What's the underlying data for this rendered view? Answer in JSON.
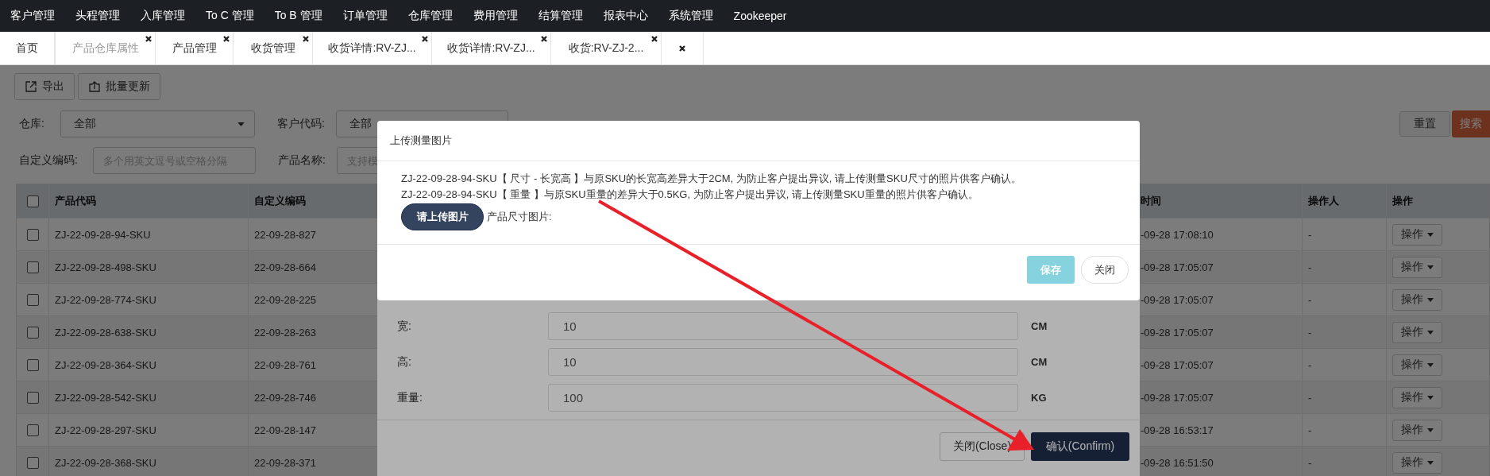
{
  "nav": [
    "客户管理",
    "头程管理",
    "入库管理",
    "To C 管理",
    "To B 管理",
    "订单管理",
    "仓库管理",
    "费用管理",
    "结算管理",
    "报表中心",
    "系统管理",
    "Zookeeper"
  ],
  "tabs": [
    {
      "kind": "page",
      "label": "首页",
      "selected": false,
      "closable": false
    },
    {
      "kind": "page",
      "label": "产品仓库属性",
      "selected": true,
      "closable": true
    },
    {
      "kind": "page",
      "label": "产品管理",
      "selected": false,
      "closable": true
    },
    {
      "kind": "page",
      "label": "收货管理",
      "selected": false,
      "closable": true
    },
    {
      "kind": "page",
      "label": "收货详情:RV-ZJ...",
      "selected": false,
      "closable": true
    },
    {
      "kind": "page",
      "label": "收货详情:RV-ZJ...",
      "selected": false,
      "closable": true
    },
    {
      "kind": "page",
      "label": "收货:RV-ZJ-2...",
      "selected": false,
      "closable": true
    },
    {
      "kind": "close",
      "selected": false,
      "closable": true
    }
  ],
  "toolbar": [
    {
      "kind": "export",
      "label": "导出"
    },
    {
      "kind": "upload",
      "label": "批量更新"
    }
  ],
  "filters": {
    "row1": [
      {
        "label": "仓库:",
        "value": "全部",
        "dropdown": true
      },
      {
        "label": "客户代码:",
        "value": "全部"
      }
    ],
    "row2": [
      {
        "label": "自定义编码:",
        "placeholder": "多个用英文逗号或空格分隔"
      },
      {
        "label": "产品名称:",
        "placeholder": "支持模"
      }
    ],
    "reset": "重置",
    "search": "搜索"
  },
  "table": {
    "all_checked": false,
    "columns": [
      "产品代码",
      "自定义编码",
      "时间",
      "操作人",
      "操作"
    ],
    "rows": [
      {
        "checked": false,
        "code": "ZJ-22-09-28-94-SKU",
        "custom": "22-09-28-827",
        "time": "-09-28 17:08:10",
        "operator": "-",
        "action": "操作"
      },
      {
        "checked": false,
        "code": "ZJ-22-09-28-498-SKU",
        "custom": "22-09-28-664",
        "time": "-09-28 17:05:07",
        "operator": "-",
        "action": "操作"
      },
      {
        "checked": false,
        "code": "ZJ-22-09-28-774-SKU",
        "custom": "22-09-28-225",
        "time": "-09-28 17:05:07",
        "operator": "-",
        "action": "操作"
      },
      {
        "checked": false,
        "code": "ZJ-22-09-28-638-SKU",
        "custom": "22-09-28-263",
        "time": "-09-28 17:05:07",
        "operator": "-",
        "action": "操作"
      },
      {
        "checked": false,
        "code": "ZJ-22-09-28-364-SKU",
        "custom": "22-09-28-761",
        "time": "-09-28 17:05:07",
        "operator": "-",
        "action": "操作"
      },
      {
        "checked": false,
        "code": "ZJ-22-09-28-542-SKU",
        "custom": "22-09-28-746",
        "time": "-09-28 17:05:07",
        "operator": "-",
        "action": "操作"
      },
      {
        "checked": false,
        "code": "ZJ-22-09-28-297-SKU",
        "custom": "22-09-28-147",
        "time": "-09-28 16:53:17",
        "operator": "-",
        "action": "操作"
      },
      {
        "checked": false,
        "code": "ZJ-22-09-28-368-SKU",
        "custom": "22-09-28-371",
        "time": "-09-28 16:51:50",
        "operator": "-",
        "action": "操作"
      }
    ]
  },
  "measure_dialog": {
    "fields": [
      {
        "label": "宽:",
        "value": "10",
        "unit": "CM"
      },
      {
        "label": "高:",
        "value": "10",
        "unit": "CM"
      },
      {
        "label": "重量:",
        "value": "100",
        "unit": "KG"
      }
    ],
    "close": "关闭(Close)",
    "confirm": "确认(Confirm)"
  },
  "upload_dialog": {
    "title": "上传测量图片",
    "messages": [
      "ZJ-22-09-28-94-SKU【 尺寸 - 长宽高 】与原SKU的长宽高差异大于2CM, 为防止客户提出异议, 请上传测量SKU尺寸的照片供客户确认。",
      "ZJ-22-09-28-94-SKU【 重量 】与原SKU重量的差异大于0.5KG, 为防止客户提出异议, 请上传测量SKU重量的照片供客户确认。"
    ],
    "upload": "请上传图片",
    "image_label": "产品尺寸图片:",
    "save": "保存",
    "save_disabled": true,
    "close": "关闭"
  }
}
